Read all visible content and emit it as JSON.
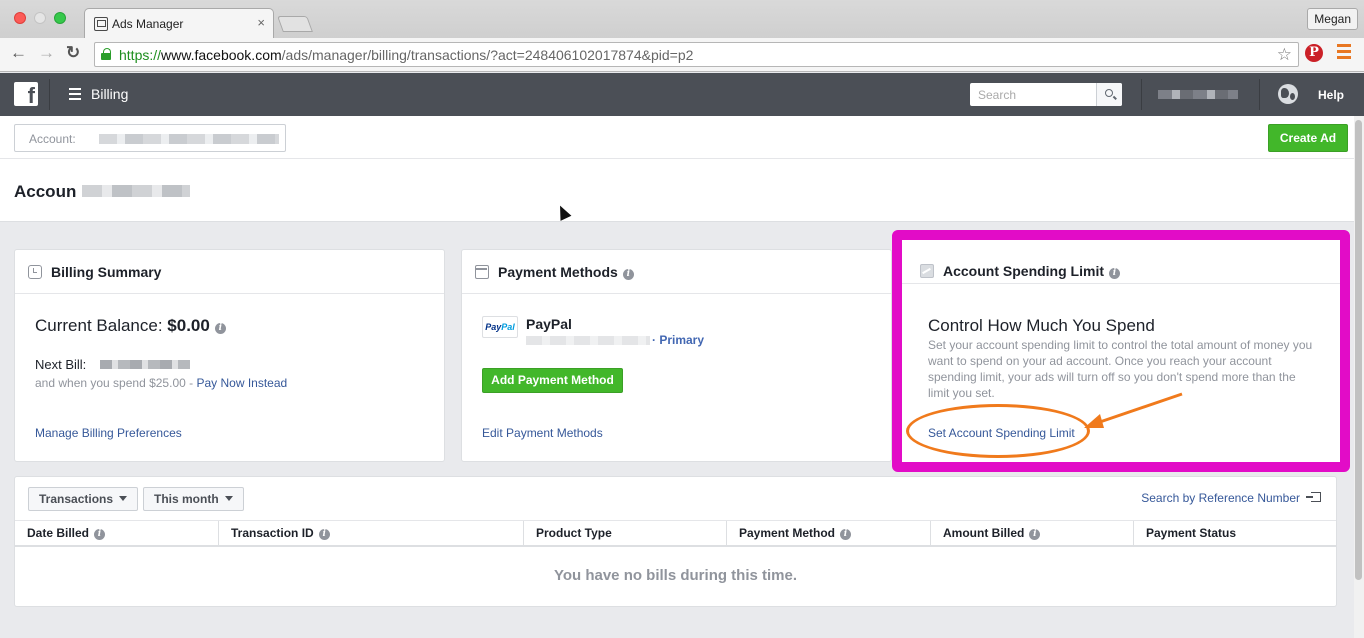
{
  "browser": {
    "tab_title": "Ads Manager",
    "tab_close": "×",
    "profile": "Megan",
    "url_scheme": "https://",
    "url_host": "www.facebook.com",
    "url_path": "/ads/manager/billing/transactions/?act=248406102017874&pid=p2"
  },
  "header": {
    "logo": "f",
    "title": "Billing",
    "search_placeholder": "Search",
    "help": "Help"
  },
  "account_bar": {
    "account_label": "Account: ",
    "create_ad": "Create Ad",
    "page_title": "Accoun"
  },
  "billing_summary": {
    "title": "Billing Summary",
    "balance_label": "Current Balance: ",
    "balance_value": "$0.00",
    "next_bill_label": "Next Bill:",
    "next_bill_note": "and when you spend $25.00 - ",
    "pay_now": "Pay Now Instead",
    "manage_link": "Manage Billing Preferences"
  },
  "payment_methods": {
    "title": "Payment Methods",
    "logo_part1": "Pay",
    "logo_part2": "Pal",
    "method_name": "PayPal",
    "primary_tag": "· Primary",
    "add_button": "Add Payment Method",
    "edit_link": "Edit Payment Methods"
  },
  "spending_limit": {
    "title": "Account Spending Limit",
    "heading": "Control How Much You Spend",
    "description": "Set your account spending limit to control the total amount of money you want to spend on your ad account. Once you reach your account spending limit, your ads will turn off so you don't spend more than the limit you set.",
    "link": "Set Account Spending Limit"
  },
  "transactions": {
    "filter_type": "Transactions",
    "filter_period": "This month",
    "ref_search": "Search by Reference Number",
    "columns": [
      "Date Billed",
      "Transaction ID",
      "Product Type",
      "Payment Method",
      "Amount Billed",
      "Payment Status"
    ],
    "empty_message": "You have no bills during this time."
  },
  "colors": {
    "facebook_header": "#4b4f56",
    "green_button": "#42b72a",
    "link_blue": "#365899",
    "highlight_magenta": "#e20cc7",
    "annotation_orange": "#f07a1c"
  }
}
